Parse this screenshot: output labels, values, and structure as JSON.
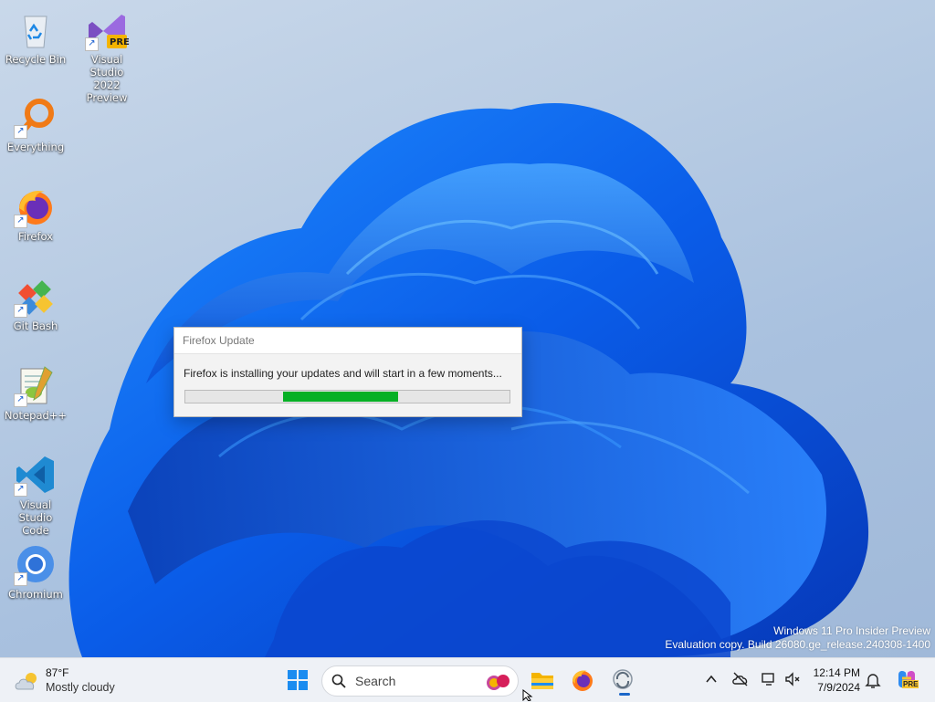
{
  "desktop": {
    "icons": [
      {
        "label": "Recycle Bin"
      },
      {
        "label": "Visual Studio\n2022 Preview",
        "badge": "PRE"
      },
      {
        "label": "Everything"
      },
      {
        "label": "Firefox"
      },
      {
        "label": "Git Bash"
      },
      {
        "label": "Notepad++"
      },
      {
        "label": "Visual Studio\nCode"
      },
      {
        "label": "Chromium"
      }
    ]
  },
  "dialog": {
    "title": "Firefox Update",
    "message": "Firefox is installing your updates and will start in a few moments...",
    "progress_state": "marquee"
  },
  "watermark": {
    "line1": "Windows 11 Pro Insider Preview",
    "line2": "Evaluation copy. Build 26080.ge_release.240308-1400"
  },
  "taskbar": {
    "weather": {
      "temp": "87°F",
      "condition": "Mostly cloudy",
      "icon": "partly-cloudy-icon"
    },
    "search": {
      "placeholder": "Search"
    },
    "pinned": [
      {
        "name": "file-explorer",
        "icon": "folder-icon"
      },
      {
        "name": "firefox",
        "icon": "firefox-icon"
      },
      {
        "name": "firefox-updater",
        "icon": "updater-icon",
        "running": true
      }
    ],
    "clock": {
      "time": "12:14 PM",
      "date": "7/9/2024"
    },
    "copilot_badge": "PRE"
  },
  "colors": {
    "accent": "#1b67c9",
    "progress": "#06b025"
  }
}
